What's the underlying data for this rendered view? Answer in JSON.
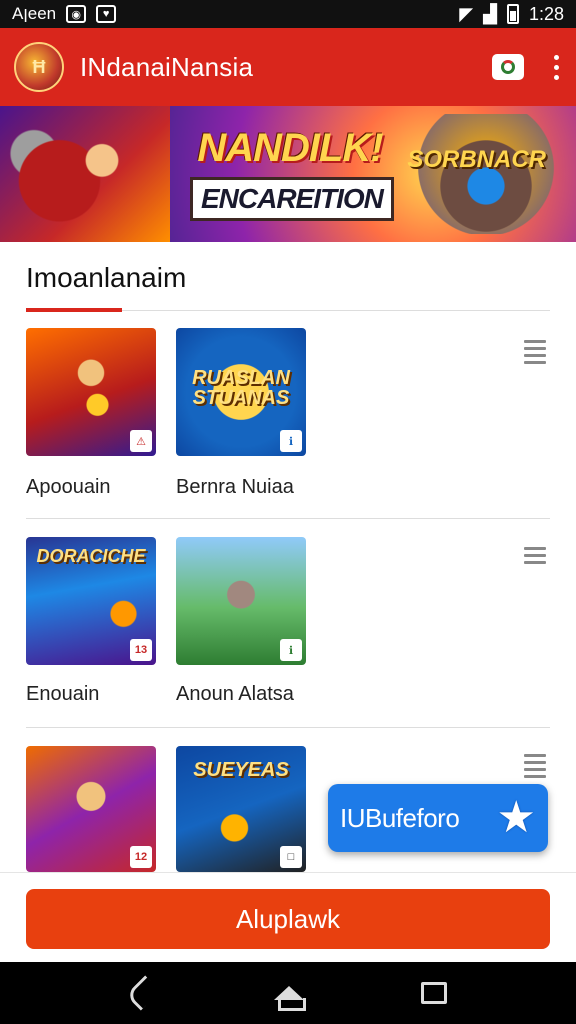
{
  "status_bar": {
    "carrier": "Aןeen",
    "time": "1:28"
  },
  "app_bar": {
    "logo_text": "Ħ",
    "title": "INdanaiNansia"
  },
  "banner": {
    "line1": "NANDILK!",
    "line2": "ENCAREITION",
    "badge_text": "SORBNACR"
  },
  "section": {
    "title": "Imoanlanaim"
  },
  "games": [
    {
      "label": "Apoouain",
      "caption": "",
      "badge": ""
    },
    {
      "label": "Bernra Nuiaa",
      "caption": "RUASLAN STUANAS",
      "badge": ""
    },
    {
      "label": "Enouain",
      "caption": "DORACICHE",
      "badge": "13"
    },
    {
      "label": "Anoun Alatsa",
      "caption": "",
      "badge": ""
    },
    {
      "label": "",
      "caption": "",
      "badge": "12"
    },
    {
      "label": "",
      "caption": "SUEYEAS",
      "badge": ""
    }
  ],
  "promo": {
    "text": "IUBufeforo",
    "star": "★"
  },
  "cta": {
    "label": "Aluplawk"
  }
}
